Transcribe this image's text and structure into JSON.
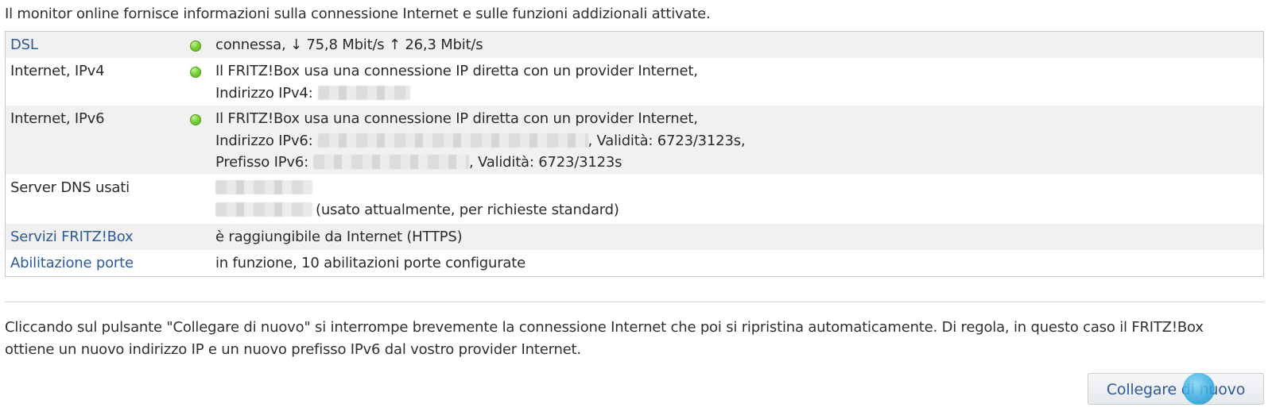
{
  "intro_text": "Il monitor online fornisce informazioni sulla connessione Internet e sulle funzioni addizionali attivate.",
  "rows": [
    {
      "label": "DSL",
      "status": "green",
      "lines": [
        "connessa, ↓ 75,8 Mbit/s ↑ 26,3 Mbit/s"
      ]
    },
    {
      "label": "Internet, IPv4",
      "status": "green",
      "line1": "Il FRITZ!Box usa una connessione IP diretta con un provider Internet,",
      "line2_prefix": "Indirizzo IPv4:"
    },
    {
      "label": "Internet, IPv6",
      "status": "green",
      "line1": "Il FRITZ!Box usa una connessione IP diretta con un provider Internet,",
      "line2_prefix": "Indirizzo IPv6:",
      "line2_suffix": ", Validità: 6723/3123s,",
      "line3_prefix": "Prefisso IPv6:",
      "line3_suffix": ", Validità: 6723/3123s"
    },
    {
      "label": "Server DNS usati",
      "line2_suffix": "(usato attualmente, per richieste standard)"
    },
    {
      "label": "Servizi FRITZ!Box",
      "line1": "è raggiungibile da Internet (HTTPS)"
    },
    {
      "label": "Abilitazione porte",
      "line1": "in funzione, 10 abilitazioni porte configurate"
    }
  ],
  "note_text": "Cliccando sul pulsante \"Collegare di nuovo\" si interrompe brevemente la connessione Internet che poi si ripristina automaticamente. Di regola, in questo caso il FRITZ!Box ottiene un nuovo indirizzo IP e un nuovo prefisso IPv6 dal vostro provider Internet.",
  "reconnect_button_label": "Collegare di nuovo",
  "colors": {
    "link": "#2e5a97",
    "led_green": "#6cc72e",
    "row_shade": "#f1f1f1"
  }
}
